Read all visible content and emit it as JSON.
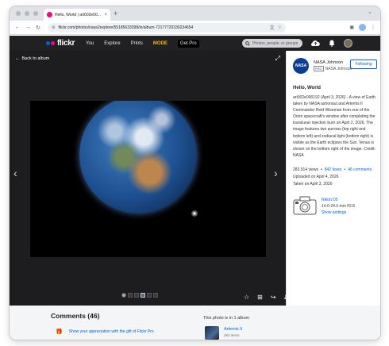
{
  "browser": {
    "tab_title": "Hello, World | art002e00...",
    "tab_close": "×",
    "new_tab": "+",
    "tab_menu": "⌄",
    "url": "flickr.com/photos/nasa2explore/55185633398/in/album-72177720330234654",
    "icons": [
      "back-icon",
      "forward-icon",
      "reload-icon",
      "site-info-icon",
      "translate-icon",
      "bookmark-star-icon",
      "extensions-icon",
      "profile-icon",
      "menu-icon"
    ]
  },
  "nav": {
    "logo": "flickr",
    "menu": [
      "You",
      "Explore",
      "Prints"
    ],
    "mode": "MODE",
    "get_pro": "Get Pro",
    "search_placeholder": "Photos, people, or groups",
    "icons": [
      "upload-cloud-icon",
      "notification-bell-icon",
      "user-avatar"
    ],
    "colors": {
      "brand_blue": "#0063dc",
      "brand_pink": "#ff0084",
      "mode": "#ffb400"
    }
  },
  "viewer": {
    "back_label": "Back to album",
    "thumbnail_count": 6,
    "actions": [
      "fave-star-icon",
      "add-to-gallery-icon",
      "share-icon",
      "download-icon"
    ]
  },
  "owner": {
    "logo_text": "NASA",
    "name": "NASA Johnson",
    "pro_badge": "PRO",
    "pro_name": "NASA Johnson",
    "follow_label": "Following"
  },
  "photo": {
    "title": "Hello, World",
    "description": "art002e000192 (April 3, 2026) - A view of Earth taken by NASA astronaut and Artemis II Commander Reid Wiseman from one of the Orion spacecraft's window after completing the translunar injection burn on April 2, 2026. The image features two auroras (top right and bottom left) and zodiacal light (bottom right) is visible as the Earth eclipses the Sun. Venus is shown on the bottom right of the image. Credit: NASA",
    "views": "283,914 views",
    "faves": "842 faves",
    "comments": "46 comments",
    "separator": "•",
    "uploaded": "Uploaded on April 4, 2026",
    "taken": "Taken on April 3, 2026"
  },
  "camera": {
    "name": "Nikon D5",
    "specs": "14.0-24.0 mm f/2.8",
    "settings_link": "Show settings"
  },
  "comments": {
    "title": "Comments (46)",
    "gift_text": "Show your appreciation with the gift of Flickr Pro"
  },
  "album": {
    "header": "This photo is in 1 album",
    "name": "Artemis II",
    "count": "362 items"
  }
}
